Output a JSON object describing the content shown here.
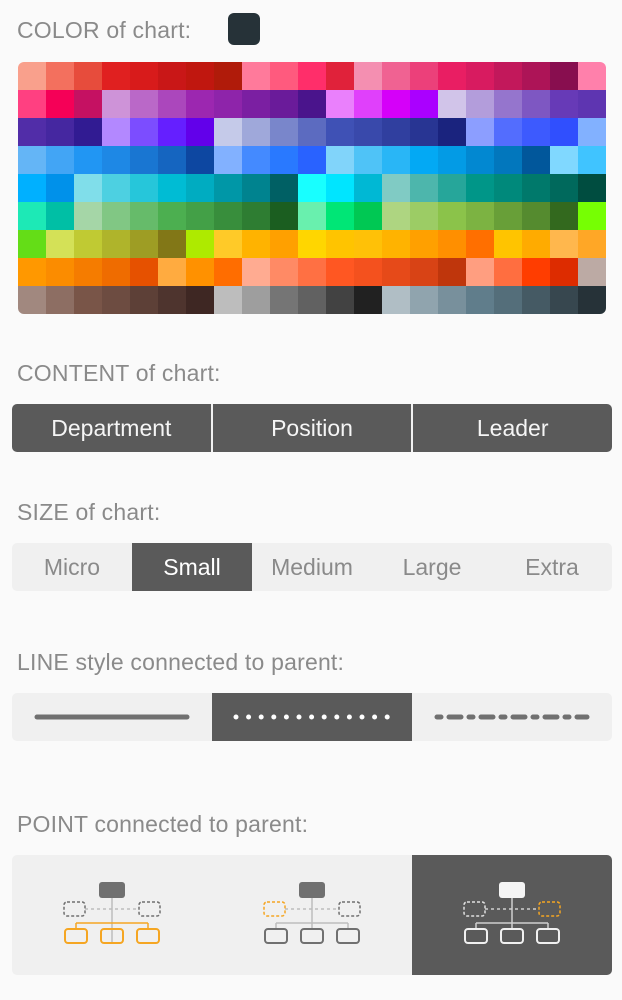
{
  "color": {
    "label": "COLOR of chart:",
    "selected": "#263238",
    "palette": [
      "#F9A08C",
      "#F3705E",
      "#E74C3C",
      "#E02020",
      "#D81B1B",
      "#C91717",
      "#C0170F",
      "#B01B0A",
      "#FF7A9B",
      "#FF5A7E",
      "#FF2E6A",
      "#E0223A",
      "#F48FB1",
      "#F06292",
      "#EC407A",
      "#E91E63",
      "#D81B60",
      "#C2185B",
      "#AD1457",
      "#880E4F",
      "#FF80AB",
      "#FF4081",
      "#F50057",
      "#C51162",
      "#CE93D8",
      "#BA68C8",
      "#AB47BC",
      "#9C27B0",
      "#8E24AA",
      "#7B1FA2",
      "#6A1B9A",
      "#4A148C",
      "#EA80FC",
      "#E040FB",
      "#D500F9",
      "#AA00FF",
      "#D1C4E9",
      "#B39DDB",
      "#9575CD",
      "#7E57C2",
      "#673AB7",
      "#5E35B1",
      "#512DA8",
      "#4527A0",
      "#311B92",
      "#B388FF",
      "#7C4DFF",
      "#651FFF",
      "#6200EA",
      "#C5CAE9",
      "#9FA8DA",
      "#7986CB",
      "#5C6BC0",
      "#3F51B5",
      "#3949AB",
      "#303F9F",
      "#283593",
      "#1A237E",
      "#8C9EFF",
      "#536DFE",
      "#3D5AFE",
      "#304FFE",
      "#82B1FF",
      "#64B5F6",
      "#42A5F5",
      "#2196F3",
      "#1E88E5",
      "#1976D2",
      "#1565C0",
      "#0D47A1",
      "#82B1FF",
      "#448AFF",
      "#2979FF",
      "#2962FF",
      "#81D4FA",
      "#4FC3F7",
      "#29B6F6",
      "#03A9F4",
      "#039BE5",
      "#0288D1",
      "#0277BD",
      "#01579B",
      "#80D8FF",
      "#40C4FF",
      "#00B0FF",
      "#0091EA",
      "#80DEEA",
      "#4DD0E1",
      "#26C6DA",
      "#00BCD4",
      "#00ACC1",
      "#0097A7",
      "#00838F",
      "#006064",
      "#18FFFF",
      "#00E5FF",
      "#00B8D4",
      "#80CBC4",
      "#4DB6AC",
      "#26A69A",
      "#009688",
      "#00897B",
      "#00796B",
      "#00695C",
      "#004D40",
      "#1DE9B6",
      "#00BFA5",
      "#A5D6A7",
      "#81C784",
      "#66BB6A",
      "#4CAF50",
      "#43A047",
      "#388E3C",
      "#2E7D32",
      "#1B5E20",
      "#69F0AE",
      "#00E676",
      "#00C853",
      "#AED581",
      "#9CCC65",
      "#8BC34A",
      "#7CB342",
      "#689F38",
      "#558B2F",
      "#33691E",
      "#76FF03",
      "#64DD17",
      "#D4E157",
      "#C0CA33",
      "#AFB42B",
      "#9E9D24",
      "#827717",
      "#AEEA00",
      "#FFCA28",
      "#FFB300",
      "#FFA000",
      "#FFD600",
      "#FFC400",
      "#FFC107",
      "#FFB300",
      "#FFA000",
      "#FF8F00",
      "#FF6F00",
      "#FFC400",
      "#FFAB00",
      "#FFB74D",
      "#FFA726",
      "#FF9800",
      "#FB8C00",
      "#F57C00",
      "#EF6C00",
      "#E65100",
      "#FFAB40",
      "#FF9100",
      "#FF6D00",
      "#FFAB91",
      "#FF8A65",
      "#FF7043",
      "#FF5722",
      "#F4511E",
      "#E64A19",
      "#D84315",
      "#BF360C",
      "#FF9E80",
      "#FF6E40",
      "#FF3D00",
      "#DD2C00",
      "#BCAAA4",
      "#A1887F",
      "#8D6E63",
      "#795548",
      "#6D4C41",
      "#5D4037",
      "#4E342E",
      "#3E2723",
      "#BDBDBD",
      "#9E9E9E",
      "#757575",
      "#616161",
      "#424242",
      "#212121",
      "#B0BEC5",
      "#90A4AE",
      "#78909C",
      "#607D8B",
      "#546E7A",
      "#455A64",
      "#37474F",
      "#263238"
    ]
  },
  "content": {
    "label": "CONTENT of chart:",
    "options": [
      "Department",
      "Position",
      "Leader"
    ]
  },
  "size": {
    "label": "SIZE of chart:",
    "options": [
      "Micro",
      "Small",
      "Medium",
      "Large",
      "Extra"
    ],
    "selected": "Small"
  },
  "line": {
    "label": "LINE style connected to parent:",
    "options": [
      "solid-line-icon",
      "dotted-line-icon",
      "dash-dot-line-icon"
    ],
    "selected": "dotted-line-icon"
  },
  "point": {
    "label": "POINT connected to parent:",
    "options": [
      "point-style-1-icon",
      "point-style-2-icon",
      "point-style-3-icon"
    ],
    "selected": "point-style-3-icon",
    "accent": "#F5A623"
  }
}
